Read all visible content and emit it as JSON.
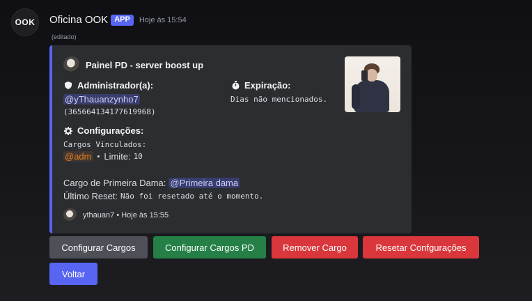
{
  "message": {
    "avatar_text": "OOK",
    "author": "Oficina OOK",
    "app_badge": "APP",
    "timestamp": "Hoje às 15:54",
    "edited": "(editado)"
  },
  "embed": {
    "accent_color": "#5865f2",
    "author_name": "Painel PD - server boost up",
    "admin": {
      "label": "Administrador(a):",
      "icon": "shield-icon",
      "mention": "@yThauanzynho7",
      "id": "(365664134177619968)"
    },
    "expiration": {
      "label": "Expiração:",
      "icon": "stopwatch-icon",
      "value": "Dias não mencionados."
    },
    "config": {
      "label": "Configurações:",
      "icon": "gear-icon",
      "linked_roles_label": "Cargos Vinculados:",
      "role": "@adm",
      "separator": "•",
      "limit_label": "Limite:",
      "limit_value": "10"
    },
    "first_lady": {
      "label": "Cargo de Primeira Dama:",
      "mention": "@Primeira dama"
    },
    "last_reset": {
      "label": "Último Reset:",
      "value": "Não foi resetado até o momento."
    },
    "footer": {
      "text": "ythauan7 • Hoje às 15:55"
    }
  },
  "buttons": {
    "configure_roles": "Configurar Cargos",
    "configure_roles_pd": "Configurar Cargos PD",
    "remove_role": "Remover Cargo",
    "reset_settings": "Resetar Confgurações",
    "back": "Voltar"
  }
}
